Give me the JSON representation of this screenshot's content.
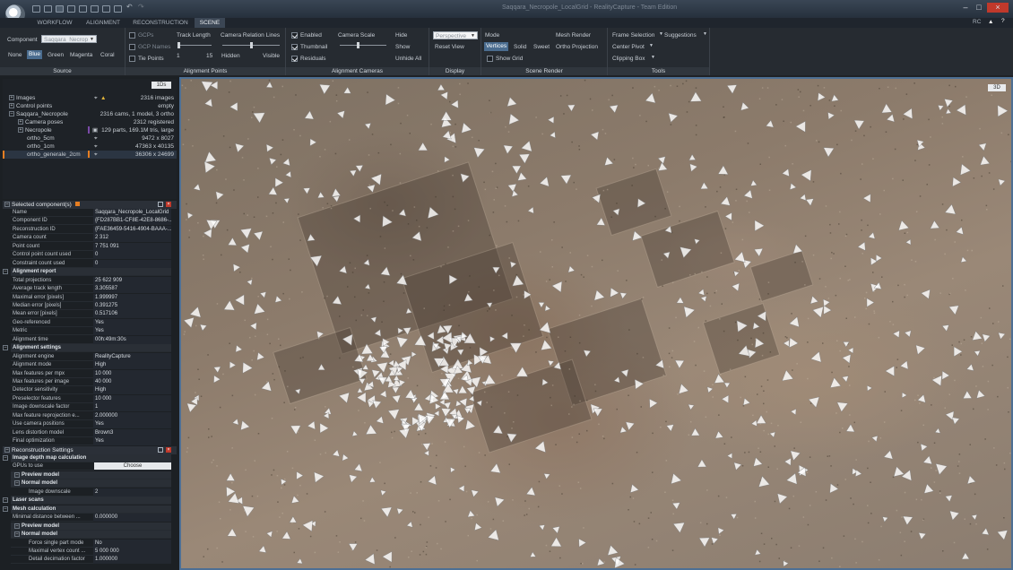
{
  "window": {
    "title": "Saqqara_Necropole_LocalGrid - RealityCapture - Team Edition",
    "rc_label": "RC"
  },
  "tabs": [
    "WORKFLOW",
    "ALIGNMENT",
    "RECONSTRUCTION",
    "SCENE"
  ],
  "active_tab": "SCENE",
  "ribbon": {
    "source": {
      "title": "Source",
      "component_label": "Component",
      "component_value": "Saqqara_Necrop",
      "colors": [
        "None",
        "Blue",
        "Green",
        "Magenta",
        "Coral"
      ],
      "selected_color": "Blue"
    },
    "alignment_points": {
      "title": "Alignment Points",
      "gcps": "GCPs",
      "gcp_names": "GCP Names",
      "tie_points": "Tie Points",
      "track_length": "Track Length",
      "track_min": "1",
      "track_max": "15",
      "relation_lines": "Camera Relation Lines",
      "hidden": "Hidden",
      "visible": "Visible"
    },
    "alignment_cameras": {
      "title": "Alignment Cameras",
      "enabled": "Enabled",
      "thumbnail": "Thumbnail",
      "residuals": "Residuals",
      "camera_scale": "Camera Scale",
      "hide": "Hide",
      "show": "Show",
      "unhide_all": "Unhide All"
    },
    "display": {
      "title": "Display",
      "projection": "Perspective",
      "reset_view": "Reset View"
    },
    "scene_render": {
      "title": "Scene Render",
      "mode": "Mode",
      "modes": [
        "Vertices",
        "Solid",
        "Sweet"
      ],
      "selected_mode": "Vertices",
      "show_grid": "Show Grid",
      "mesh_render": "Mesh Render",
      "ortho_projection": "Ortho Projection"
    },
    "tools": {
      "title": "Tools",
      "frame_selection": "Frame Selection",
      "suggestions": "Suggestions",
      "center_pivot": "Center Pivot",
      "clipping_box": "Clipping Box"
    }
  },
  "tree": {
    "ds_button": "1Ds",
    "items": [
      {
        "label": "Images",
        "value": "2316 images"
      },
      {
        "label": "Control points",
        "value": "empty"
      },
      {
        "label": "Saqqara_Necropole_LocalGrid",
        "value": "2316 cams, 1 model, 3 ortho"
      },
      {
        "label": "Camera poses",
        "value": "2312 registered"
      },
      {
        "label": "Necropole",
        "value": "129 parts, 169.1M tris, large"
      },
      {
        "label": "ortho_5cm",
        "value": "9472 x 8027"
      },
      {
        "label": "ortho_1cm",
        "value": "47363 x 40135"
      },
      {
        "label": "ortho_generale_2cm",
        "value": "36306 x 24699"
      }
    ]
  },
  "selected_panel": {
    "title": "Selected component(s)",
    "rows": [
      {
        "k": "Name",
        "v": "Saqqara_Necropole_LocalGrid"
      },
      {
        "k": "Component ID",
        "v": "{FD287BB1-CF8E-42E8-8686-..."
      },
      {
        "k": "Reconstruction ID",
        "v": "{FAE36459-5416-4904-BAAA-..."
      },
      {
        "k": "Camera count",
        "v": "2 312"
      },
      {
        "k": "Point count",
        "v": "7 751 091"
      },
      {
        "k": "Control point count used",
        "v": "0"
      },
      {
        "k": "Constraint count used",
        "v": "0"
      },
      {
        "k": "Alignment report",
        "v": "",
        "sec": true
      },
      {
        "k": "Total projections",
        "v": "25 622 909"
      },
      {
        "k": "Average track length",
        "v": "3.305587"
      },
      {
        "k": "Maximal error [pixels]",
        "v": "1.999997"
      },
      {
        "k": "Median error [pixels]",
        "v": "0.391275"
      },
      {
        "k": "Mean error [pixels]",
        "v": "0.517106"
      },
      {
        "k": "Geo-referenced",
        "v": "Yes"
      },
      {
        "k": "Metric",
        "v": "Yes"
      },
      {
        "k": "Alignment time",
        "v": "00h:49m:30s"
      },
      {
        "k": "Alignment settings",
        "v": "",
        "sec": true
      },
      {
        "k": "Alignment engine",
        "v": "RealityCapture"
      },
      {
        "k": "Alignment mode",
        "v": "High"
      },
      {
        "k": "Max features per mpx",
        "v": "10 000"
      },
      {
        "k": "Max features per image",
        "v": "40 000"
      },
      {
        "k": "Detector sensitivity",
        "v": "High"
      },
      {
        "k": "Preselector features",
        "v": "10 000"
      },
      {
        "k": "Image downscale factor",
        "v": "1"
      },
      {
        "k": "Max feature reprojection e...",
        "v": "2.000000"
      },
      {
        "k": "Use camera positions",
        "v": "Yes"
      },
      {
        "k": "Lens distortion model",
        "v": "Brown3"
      },
      {
        "k": "Final optimization",
        "v": "Yes"
      }
    ]
  },
  "recon_panel": {
    "title": "Reconstruction Settings",
    "choose_label": "Choose",
    "rows": [
      {
        "k": "Image depth map calculation",
        "v": "",
        "sec": true
      },
      {
        "k": "GPUs to use",
        "v": "",
        "choose": true
      },
      {
        "k": "Preview model",
        "v": "",
        "sec": true,
        "sub": true
      },
      {
        "k": "Normal model",
        "v": "",
        "sec": true,
        "sub": true
      },
      {
        "k": "Image downscale",
        "v": "2",
        "sub2": true
      },
      {
        "k": "Laser scans",
        "v": "",
        "sec": true
      },
      {
        "k": "Mesh calculation",
        "v": "",
        "sec": true
      },
      {
        "k": "Minimal distance between ...",
        "v": "0.000000"
      },
      {
        "k": "Preview model",
        "v": "",
        "sec": true,
        "sub": true
      },
      {
        "k": "Normal model",
        "v": "",
        "sec": true,
        "sub": true
      },
      {
        "k": "Force single part mode",
        "v": "No",
        "sub2": true
      },
      {
        "k": "Maximal vertex count ...",
        "v": "5 000 000",
        "sub2": true
      },
      {
        "k": "Detail decimation factor",
        "v": "1.000000",
        "sub2": true
      }
    ]
  },
  "viewport": {
    "mode_button": "3D"
  }
}
